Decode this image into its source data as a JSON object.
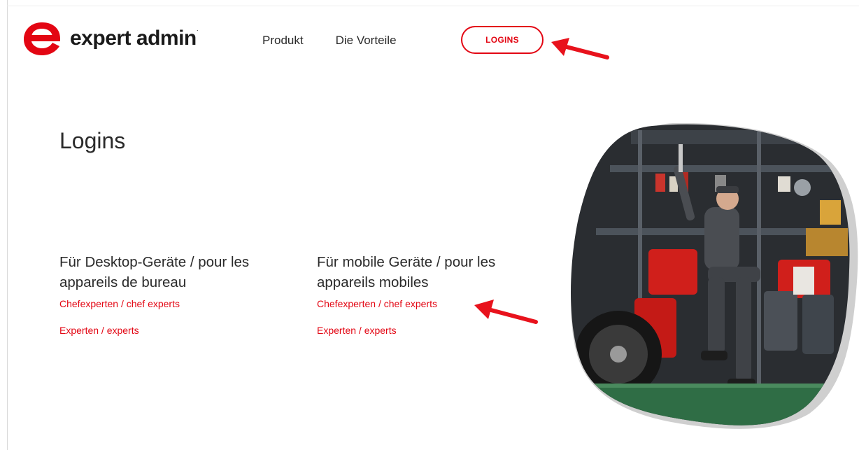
{
  "header": {
    "logo_text": "expert admin",
    "logo_mark_color": "#e30613",
    "nav": [
      {
        "label": "Produkt"
      },
      {
        "label": "Die Vorteile"
      }
    ],
    "login_button": "LOGINS"
  },
  "main": {
    "title": "Logins",
    "columns": [
      {
        "heading": "Für Desktop-Geräte / pour les appareils de bureau",
        "links": [
          "Chefexperten / chef experts",
          "Experten / experts"
        ]
      },
      {
        "heading": "Für mobile Geräte / pour les appareils mobiles",
        "links": [
          "Chefexperten / chef experts",
          "Experten / experts"
        ]
      }
    ]
  },
  "colors": {
    "accent": "#e30613",
    "text": "#2a2a2a",
    "annotation_arrow": "#e8121c"
  },
  "icons": {
    "logo": "expert-admin-e-logo",
    "annotation": "red-arrow"
  }
}
